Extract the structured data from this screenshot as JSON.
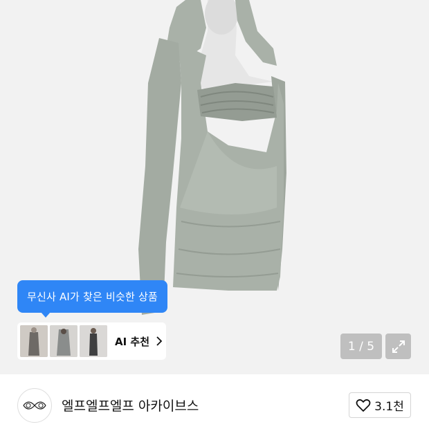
{
  "hero": {
    "image_alt": "product photo: sage grey hooded long-sleeve ruched mini dress on mannequin",
    "background": "#f2f2f2",
    "garment_color": "#a9b1a8"
  },
  "ai_recommend": {
    "tooltip": "무신사 AI가 찾은 비슷한 상품",
    "button_label": "AI 추천",
    "accent": "#2f86f6",
    "thumbnails": [
      "thumb-1",
      "thumb-2",
      "thumb-3"
    ]
  },
  "gallery": {
    "counter": "1 / 5",
    "expand_icon": "expand-arrows-icon"
  },
  "shop": {
    "name": "엘프엘프엘프 아카이브스",
    "logo_icon": "shop-logo-icon",
    "like_icon": "heart-icon",
    "like_count": "3.1천"
  }
}
